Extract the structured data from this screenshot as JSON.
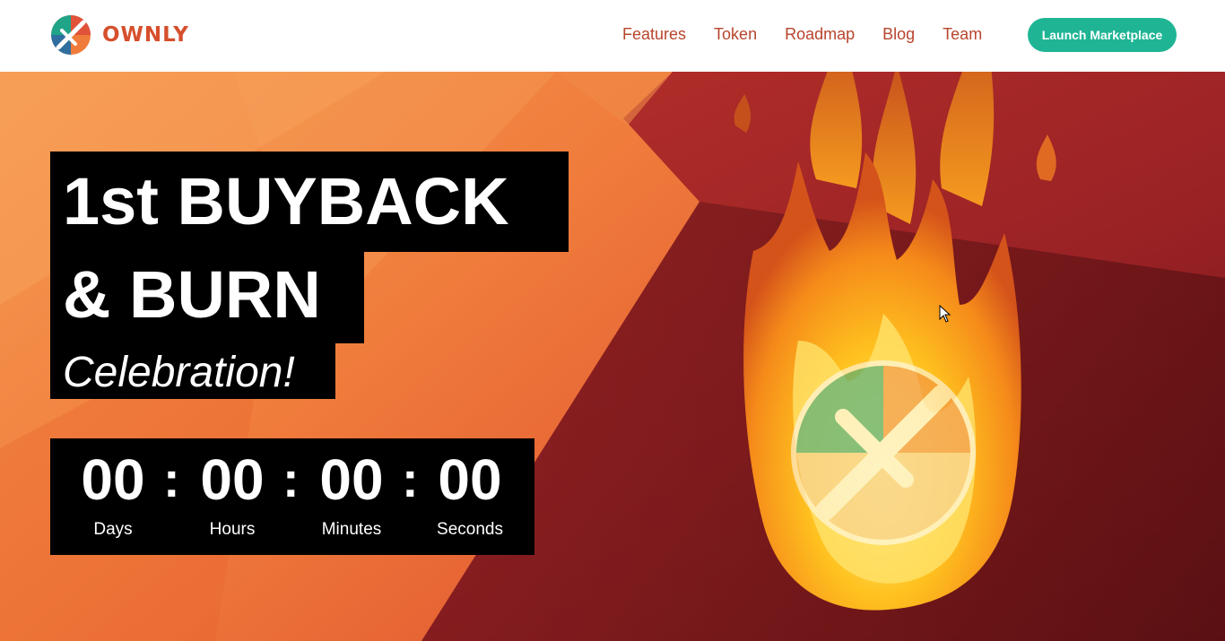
{
  "brand": {
    "name": "OWNLY"
  },
  "nav": {
    "items": [
      {
        "label": "Features"
      },
      {
        "label": "Token"
      },
      {
        "label": "Roadmap"
      },
      {
        "label": "Blog"
      },
      {
        "label": "Team"
      }
    ],
    "cta_label": "Launch Marketplace"
  },
  "hero": {
    "headline_line1": "1st BUYBACK",
    "headline_line2": "& BURN",
    "headline_line3": "Celebration!",
    "countdown": {
      "days": {
        "value": "00",
        "label": "Days"
      },
      "hours": {
        "value": "00",
        "label": "Hours"
      },
      "minutes": {
        "value": "00",
        "label": "Minutes"
      },
      "seconds": {
        "value": "00",
        "label": "Seconds"
      },
      "separator": ":"
    }
  },
  "colors": {
    "brand_orange": "#d64f2c",
    "nav_text": "#b8452c",
    "cta_green": "#1fb594",
    "hero_orange": "#f07c3c",
    "hero_red": "#b3282a",
    "panel_black": "#000000"
  },
  "icons": [
    "ownly-logo-icon",
    "burning-ownly-logo-icon",
    "cursor-icon"
  ]
}
